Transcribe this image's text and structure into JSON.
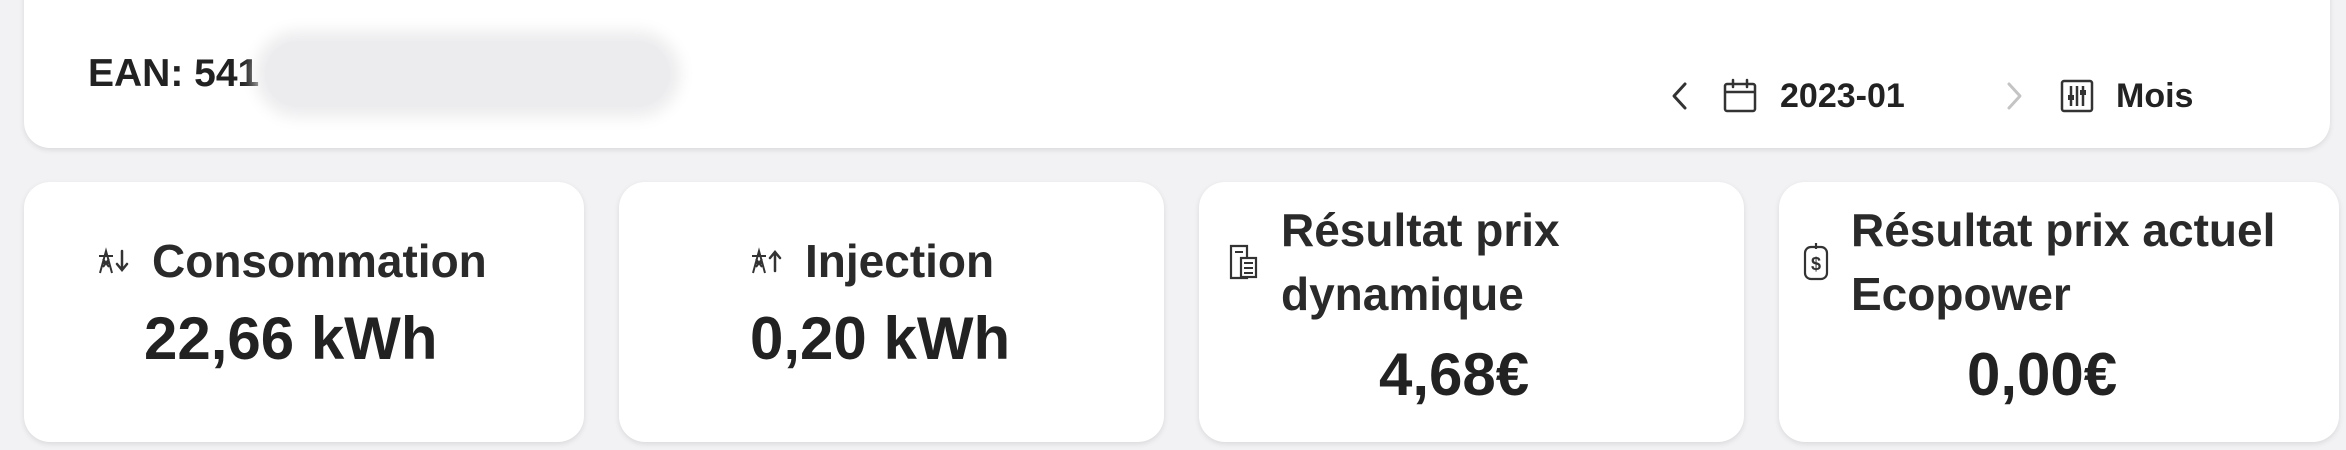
{
  "header": {
    "ean_label": "EAN: 541",
    "date": "2023-01",
    "period": "Mois",
    "icons": {
      "prev": "chevron-left-icon",
      "calendar": "calendar-icon",
      "next": "chevron-right-icon",
      "period": "adjust-icon"
    }
  },
  "cards": [
    {
      "title": "Consommation",
      "value": "22,66 kWh",
      "icon": "power-line-down-icon"
    },
    {
      "title": "Injection",
      "value": "0,20 kWh",
      "icon": "power-line-up-icon"
    },
    {
      "title_line1": "Résultat prix",
      "title_line2": "dynamique",
      "value": "4,68€",
      "icon": "invoice-icon"
    },
    {
      "title_line1": "Résultat prix actuel",
      "title_line2": "Ecopower",
      "value": "0,00€",
      "icon": "price-tag-icon"
    }
  ],
  "colors": {
    "background": "#f2f2f4",
    "card": "#ffffff",
    "text": "#222222",
    "muted_icon": "#bdbdbd"
  }
}
